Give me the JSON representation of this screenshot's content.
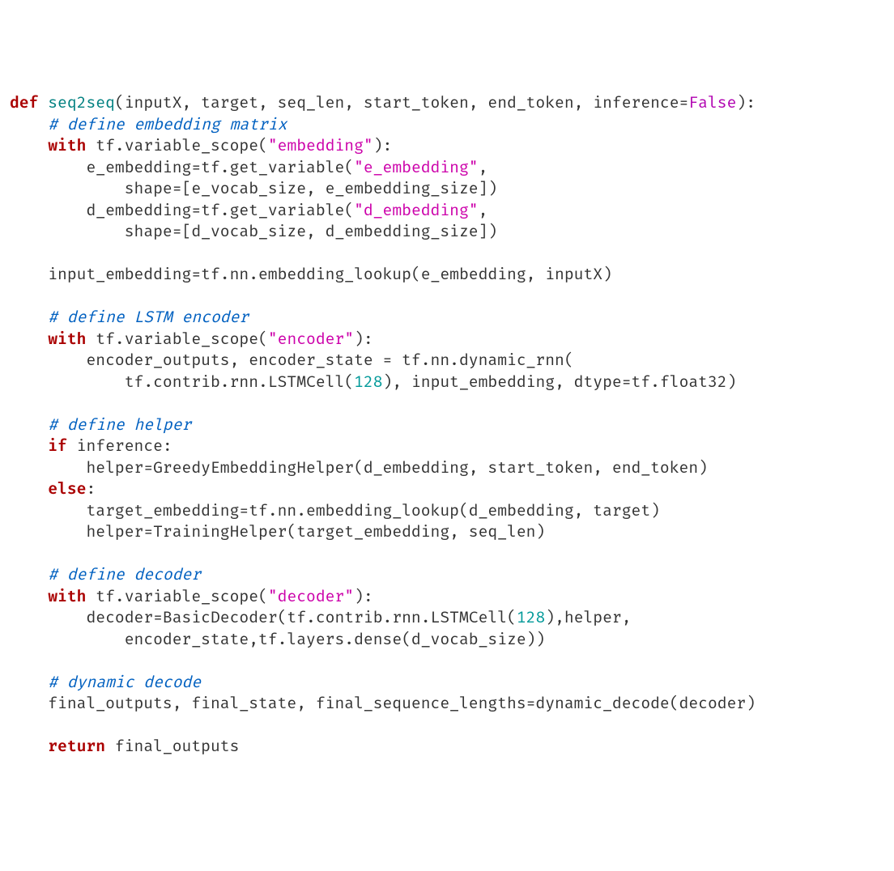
{
  "code": {
    "line01": {
      "kw": "def ",
      "fn": "seq2seq",
      "sig1": "(inputX, target, seq_len, start_token, end_token, inference=",
      "bool": "False",
      "sig2": "):"
    },
    "line02": {
      "indent": "    ",
      "cmt": "# define embedding matrix"
    },
    "line03": {
      "indent": "    ",
      "kw": "with",
      "rest1": " tf.variable_scope(",
      "str": "\"embedding\"",
      "rest2": "):"
    },
    "line04": {
      "indent": "        ",
      "rest1": "e_embedding=tf.get_variable(",
      "str": "\"e_embedding\"",
      "rest2": ","
    },
    "line05": {
      "indent": "            ",
      "rest": "shape=[e_vocab_size, e_embedding_size])"
    },
    "line06": {
      "indent": "        ",
      "rest1": "d_embedding=tf.get_variable(",
      "str": "\"d_embedding\"",
      "rest2": ","
    },
    "line07": {
      "indent": "            ",
      "rest": "shape=[d_vocab_size, d_embedding_size])"
    },
    "line08": {
      "blank": " "
    },
    "line09": {
      "indent": "    ",
      "rest": "input_embedding=tf.nn.embedding_lookup(e_embedding, inputX)"
    },
    "line10": {
      "blank": " "
    },
    "line11": {
      "indent": "    ",
      "cmt": "# define LSTM encoder"
    },
    "line12": {
      "indent": "    ",
      "kw": "with",
      "rest1": " tf.variable_scope(",
      "str": "\"encoder\"",
      "rest2": "):"
    },
    "line13": {
      "indent": "        ",
      "rest": "encoder_outputs, encoder_state = tf.nn.dynamic_rnn("
    },
    "line14": {
      "indent": "            ",
      "rest1": "tf.contrib.rnn.LSTMCell(",
      "num": "128",
      "rest2": "), input_embedding, dtype=tf.float32)"
    },
    "line15": {
      "blank": " "
    },
    "line16": {
      "indent": "    ",
      "cmt": "# define helper"
    },
    "line17": {
      "indent": "    ",
      "kw": "if",
      "rest": " inference:"
    },
    "line18": {
      "indent": "        ",
      "rest": "helper=GreedyEmbeddingHelper(d_embedding, start_token, end_token)"
    },
    "line19": {
      "indent": "    ",
      "kw": "else",
      "rest": ":"
    },
    "line20": {
      "indent": "        ",
      "rest": "target_embedding=tf.nn.embedding_lookup(d_embedding, target)"
    },
    "line21": {
      "indent": "        ",
      "rest": "helper=TrainingHelper(target_embedding, seq_len)"
    },
    "line22": {
      "blank": " "
    },
    "line23": {
      "indent": "    ",
      "cmt": "# define decoder"
    },
    "line24": {
      "indent": "    ",
      "kw": "with",
      "rest1": " tf.variable_scope(",
      "str": "\"decoder\"",
      "rest2": "):"
    },
    "line25": {
      "indent": "        ",
      "rest1": "decoder=BasicDecoder(tf.contrib.rnn.LSTMCell(",
      "num": "128",
      "rest2": "),helper,"
    },
    "line26": {
      "indent": "            ",
      "rest": "encoder_state,tf.layers.dense(d_vocab_size))"
    },
    "line27": {
      "blank": " "
    },
    "line28": {
      "indent": "    ",
      "cmt": "# dynamic decode"
    },
    "line29": {
      "indent": "    ",
      "rest": "final_outputs, final_state, final_sequence_lengths=dynamic_decode(decoder)"
    },
    "line30": {
      "blank": " "
    },
    "line31": {
      "indent": "    ",
      "kw": "return",
      "rest": " final_outputs"
    }
  }
}
